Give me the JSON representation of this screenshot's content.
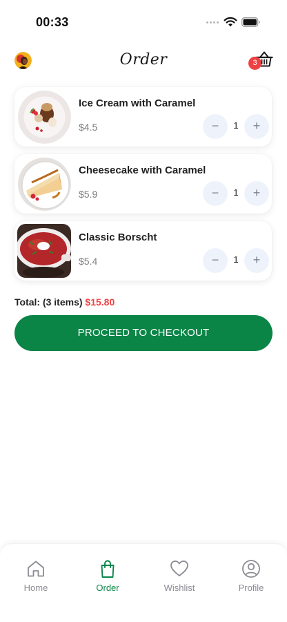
{
  "status_bar": {
    "time": "00:33"
  },
  "header": {
    "title": "Order",
    "cart_count": "3"
  },
  "cart": {
    "items": [
      {
        "name": "Ice Cream with Caramel",
        "price": "$4.5",
        "quantity": "1"
      },
      {
        "name": "Cheesecake with Caramel",
        "price": "$5.9",
        "quantity": "1"
      },
      {
        "name": "Classic Borscht",
        "price": "$5.4",
        "quantity": "1"
      }
    ],
    "minus_label": "−",
    "plus_label": "+"
  },
  "summary": {
    "total_label": "Total: (3 items)",
    "total_amount": "$15.80"
  },
  "checkout_label": "PROCEED TO CHECKOUT",
  "nav": {
    "items": [
      {
        "label": "Home",
        "icon": "home-icon"
      },
      {
        "label": "Order",
        "icon": "shopping-bag-icon",
        "active": true
      },
      {
        "label": "Wishlist",
        "icon": "heart-icon"
      },
      {
        "label": "Profile",
        "icon": "profile-icon"
      }
    ]
  },
  "colors": {
    "accent": "#0a8546",
    "badge": "#ee4143",
    "price_total": "#ee4143"
  }
}
